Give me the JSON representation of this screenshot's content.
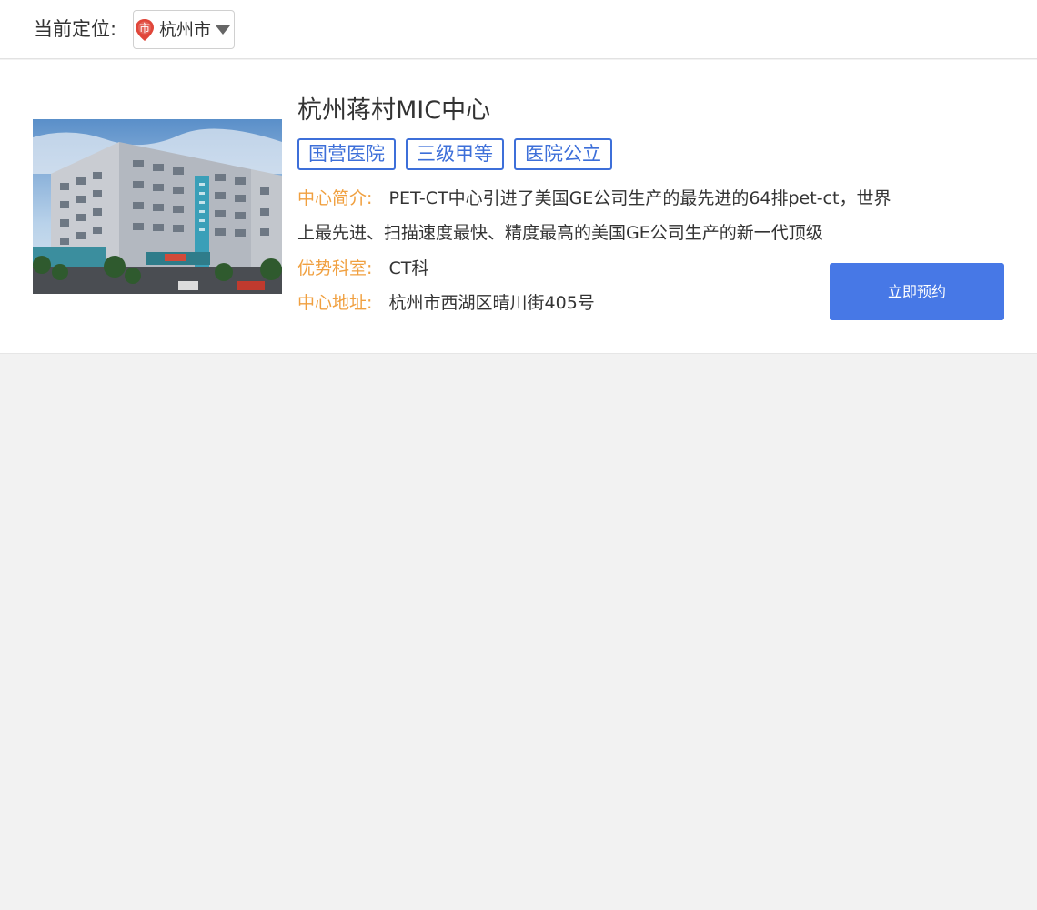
{
  "header": {
    "location_label": "当前定位:",
    "city_badge_text": "市",
    "city_name": "杭州市"
  },
  "hospital": {
    "name": "杭州蒋村MIC中心",
    "tags": [
      "国营医院",
      "三级甲等",
      "医院公立"
    ],
    "intro_label": "中心简介:",
    "intro_text": "PET-CT中心引进了美国GE公司生产的最先进的64排pet-ct，世界上最先进、扫描速度最快、精度最高的美国GE公司生产的新一代顶级",
    "dept_label": "优势科室:",
    "dept_value": "CT科",
    "addr_label": "中心地址:",
    "addr_value": "杭州市西湖区晴川街405号",
    "book_label": "立即预约"
  },
  "colors": {
    "accent_blue": "#3d6fd9",
    "button_blue": "#4778e6",
    "label_orange": "#f0a040",
    "badge_red": "#e0463a"
  }
}
